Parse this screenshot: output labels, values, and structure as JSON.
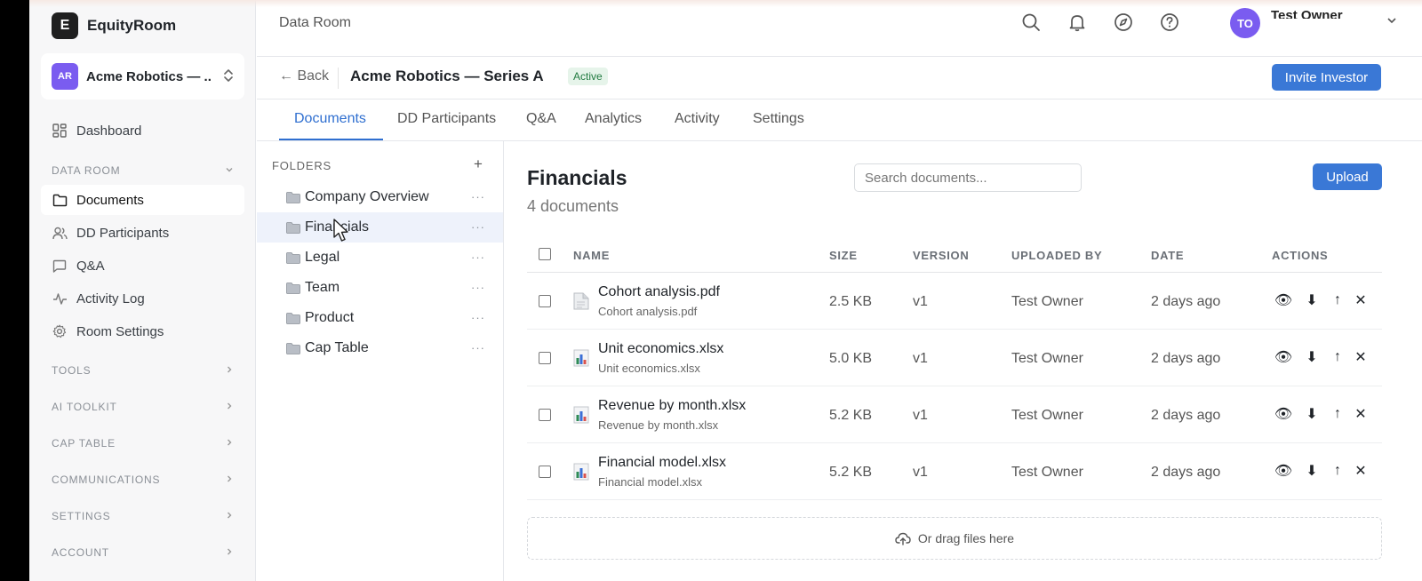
{
  "brand": {
    "logo_letter": "E",
    "name": "EquityRoom"
  },
  "org": {
    "initials": "AR",
    "name": "Acme Robotics — ...",
    "avatar_color": "#7a5cf0"
  },
  "sidebar": {
    "dashboard": "Dashboard",
    "data_room_label": "DATA ROOM",
    "items": [
      {
        "label": "Documents",
        "icon": "folder-icon",
        "active": true
      },
      {
        "label": "DD Participants",
        "icon": "users-icon"
      },
      {
        "label": "Q&A",
        "icon": "chat-icon"
      },
      {
        "label": "Activity Log",
        "icon": "activity-icon"
      },
      {
        "label": "Room Settings",
        "icon": "gear-icon"
      }
    ],
    "sections": [
      "TOOLS",
      "AI TOOLKIT",
      "CAP TABLE",
      "COMMUNICATIONS",
      "SETTINGS",
      "ACCOUNT"
    ]
  },
  "header": {
    "breadcrumb": "Data Room",
    "icons": [
      "search-icon",
      "bell-icon",
      "compass-icon",
      "help-icon"
    ],
    "user": {
      "initials": "TO",
      "name": "Test Owner"
    }
  },
  "room": {
    "back_label": "Back",
    "title": "Acme Robotics — Series A",
    "status": "Active",
    "invite_label": "Invite Investor"
  },
  "tabs": [
    "Documents",
    "DD Participants",
    "Q&A",
    "Analytics",
    "Activity",
    "Settings"
  ],
  "folders": {
    "header": "FOLDERS",
    "add": "+",
    "more": "···",
    "items": [
      "Company Overview",
      "Financials",
      "Legal",
      "Team",
      "Product",
      "Cap Table"
    ],
    "selected": "Financials"
  },
  "documents": {
    "title": "Financials",
    "count": "4 documents",
    "search_placeholder": "Search documents...",
    "upload_label": "Upload",
    "columns": [
      "NAME",
      "SIZE",
      "VERSION",
      "UPLOADED BY",
      "DATE",
      "ACTIONS"
    ],
    "rows": [
      {
        "name": "Cohort analysis.pdf",
        "sub": "Cohort analysis.pdf",
        "type": "pdf",
        "size": "2.5 KB",
        "version": "v1",
        "uploaded_by": "Test Owner",
        "date": "2 days ago"
      },
      {
        "name": "Unit economics.xlsx",
        "sub": "Unit economics.xlsx",
        "type": "xlsx",
        "size": "5.0 KB",
        "version": "v1",
        "uploaded_by": "Test Owner",
        "date": "2 days ago"
      },
      {
        "name": "Revenue by month.xlsx",
        "sub": "Revenue by month.xlsx",
        "type": "xlsx",
        "size": "5.2 KB",
        "version": "v1",
        "uploaded_by": "Test Owner",
        "date": "2 days ago"
      },
      {
        "name": "Financial model.xlsx",
        "sub": "Financial model.xlsx",
        "type": "xlsx",
        "size": "5.2 KB",
        "version": "v1",
        "uploaded_by": "Test Owner",
        "date": "2 days ago"
      }
    ],
    "actions": [
      "👁",
      "⬇",
      "↑",
      "✕"
    ],
    "drop_label": "Or drag files here"
  },
  "colors": {
    "accent": "#3a78d6",
    "tab_active": "#2f6fd0",
    "badge_bg": "#e6f4ea",
    "badge_text": "#217a40"
  }
}
